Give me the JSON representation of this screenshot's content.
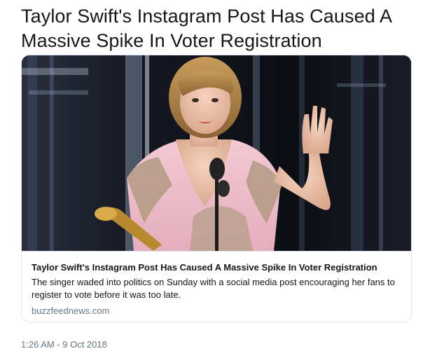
{
  "tweet": {
    "text": "Taylor Swift's Instagram Post Has Caused A Massive Spike In Voter Registration",
    "timestamp": "1:26 AM - 9 Oct 2018"
  },
  "card": {
    "image_subject": "Woman in pink gown holding a microphone stand and award, waving on stage",
    "title": "Taylor Swift's Instagram Post Has Caused A Massive Spike In Voter Registration",
    "description": "The singer waded into politics on Sunday with a social media post encouraging her fans to register to vote before it was too late.",
    "domain": "buzzfeednews.com"
  },
  "colors": {
    "text_primary": "#14171a",
    "text_secondary": "#657786",
    "card_border": "#e1e8ed"
  }
}
